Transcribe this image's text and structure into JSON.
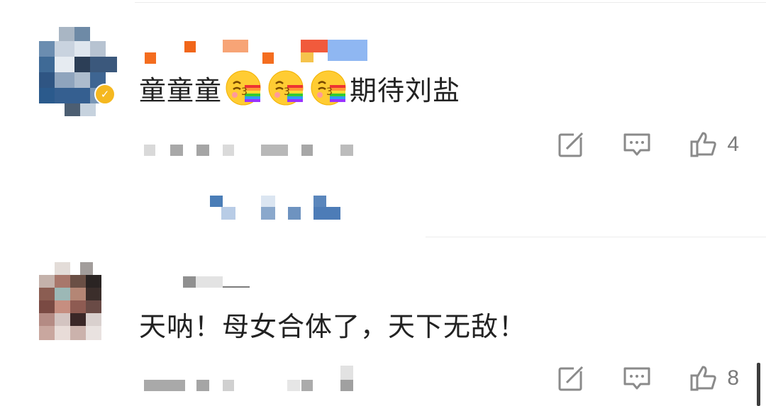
{
  "comments": [
    {
      "text_prefix": "童童童",
      "text_suffix": "期待刘盐",
      "emoji_count": 3,
      "emoji_icon": "kiss-rainbow-emoji",
      "like_count": "4",
      "has_verified_badge": true
    },
    {
      "text": "天呐！母女合体了，天下无敌！",
      "like_count": "8",
      "has_verified_badge": false
    }
  ],
  "icons": {
    "share": "share-icon",
    "comment": "comment-icon",
    "like": "thumbs-up-icon"
  },
  "colors": {
    "text": "#222222",
    "icon": "#888888",
    "count": "#7a7a7a",
    "divider": "#ececec",
    "badge": "#f5b820"
  }
}
